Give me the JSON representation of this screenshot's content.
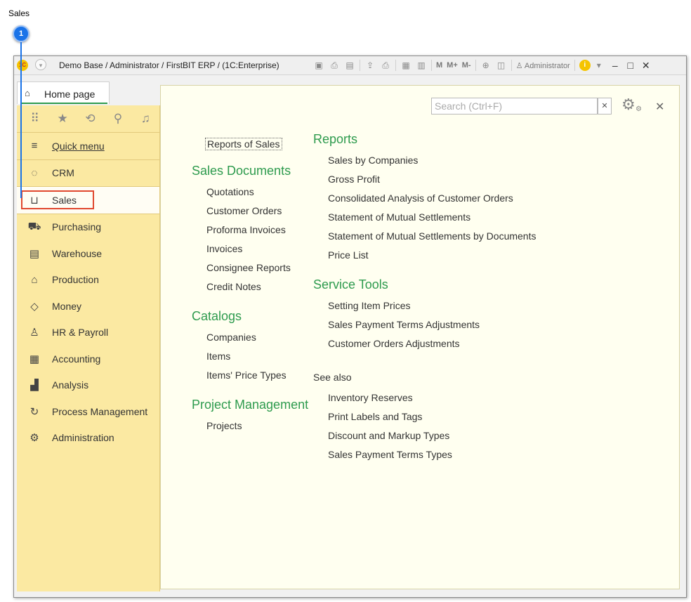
{
  "doc_title": "Sales",
  "callout": "1",
  "window": {
    "logo": "1C",
    "title": "Demo Base / Administrator / FirstBIT ERP /  (1C:Enterprise)",
    "toolbar_icons": [
      "save-icon",
      "print-icon",
      "preview-icon",
      "upload-icon",
      "print2-icon",
      "calc-icon",
      "calendar-icon"
    ],
    "m_buttons": [
      "M",
      "M+",
      "M-"
    ],
    "user": "Administrator"
  },
  "tabs": {
    "home": "Home page"
  },
  "sidebar": {
    "items": [
      {
        "label": "Quick menu",
        "icon": "hamburger-icon"
      },
      {
        "label": "CRM",
        "icon": "chat-icon"
      },
      {
        "label": "Sales",
        "icon": "basket-icon"
      },
      {
        "label": "Purchasing",
        "icon": "truck-icon"
      },
      {
        "label": "Warehouse",
        "icon": "warehouse-icon"
      },
      {
        "label": "Production",
        "icon": "factory-icon"
      },
      {
        "label": "Money",
        "icon": "money-icon"
      },
      {
        "label": "HR & Payroll",
        "icon": "person-icon"
      },
      {
        "label": "Accounting",
        "icon": "calculator-icon"
      },
      {
        "label": "Analysis",
        "icon": "chart-icon"
      },
      {
        "label": "Process Management",
        "icon": "process-icon"
      },
      {
        "label": "Administration",
        "icon": "gear-icon"
      }
    ]
  },
  "content": {
    "search_placeholder": "Search (Ctrl+F)",
    "left": {
      "report_link": "Reports of Sales",
      "groups": [
        {
          "title": "Sales Documents",
          "items": [
            "Quotations",
            "Customer Orders",
            "Proforma Invoices",
            "Invoices",
            "Consignee Reports",
            "Credit Notes"
          ]
        },
        {
          "title": "Catalogs",
          "items": [
            "Companies",
            "Items",
            "Items' Price Types"
          ]
        },
        {
          "title": "Project Management",
          "items": [
            "Projects"
          ]
        }
      ]
    },
    "right": {
      "groups": [
        {
          "title": "Reports",
          "items": [
            "Sales by Companies",
            "Gross Profit",
            "Consolidated Analysis of Customer Orders",
            "Statement of Mutual Settlements",
            "Statement of Mutual Settlements by Documents",
            "Price List"
          ]
        },
        {
          "title": "Service Tools",
          "items": [
            "Setting Item Prices",
            "Sales Payment Terms Adjustments",
            "Customer Orders Adjustments"
          ]
        }
      ],
      "see_also": {
        "title": "See also",
        "items": [
          "Inventory Reserves",
          "Print Labels and Tags",
          "Discount and Markup Types",
          "Sales Payment Terms Types"
        ]
      }
    }
  }
}
